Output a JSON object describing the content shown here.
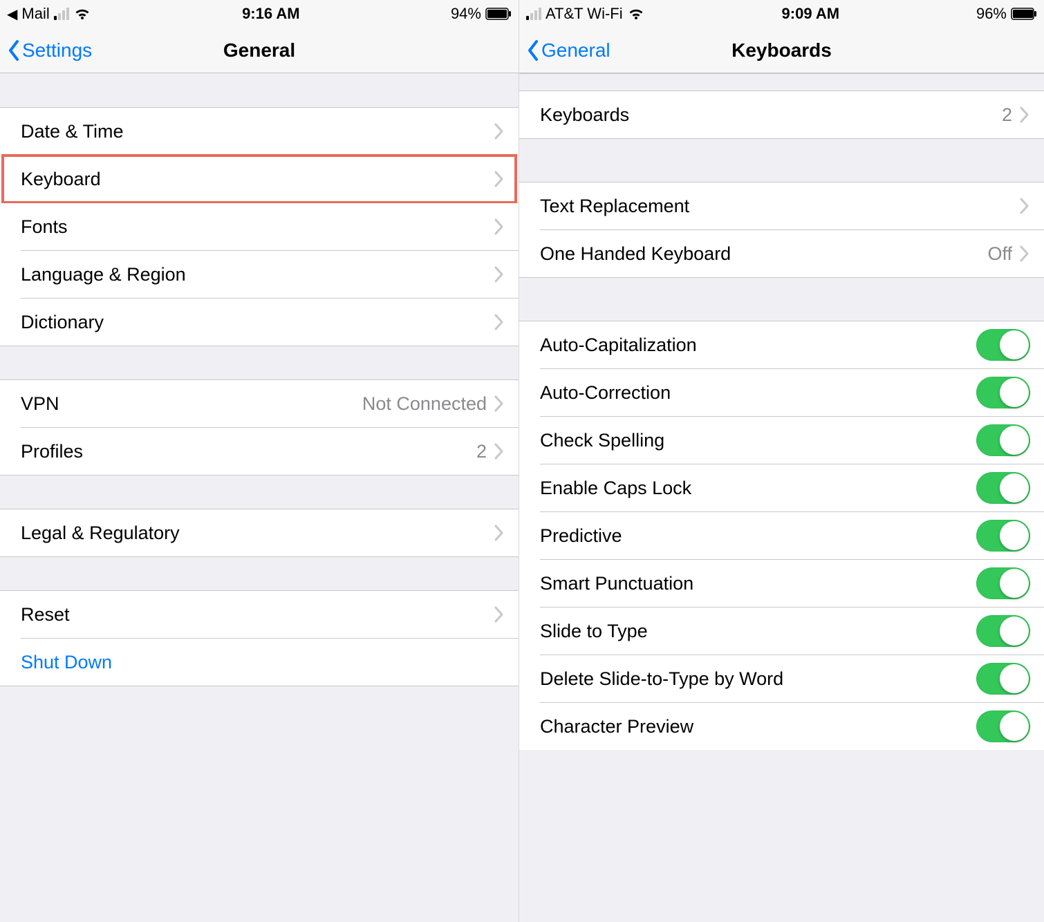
{
  "left": {
    "status": {
      "back_app_label": "Mail",
      "time": "9:16 AM",
      "battery_pct": "94%",
      "signal_active_bars": 1
    },
    "nav": {
      "back_label": "Settings",
      "title": "General"
    },
    "groups": [
      {
        "rows": [
          {
            "key": "date-time",
            "label": "Date & Time"
          },
          {
            "key": "keyboard",
            "label": "Keyboard",
            "highlight": true
          },
          {
            "key": "fonts",
            "label": "Fonts"
          },
          {
            "key": "language-region",
            "label": "Language & Region"
          },
          {
            "key": "dictionary",
            "label": "Dictionary"
          }
        ]
      },
      {
        "rows": [
          {
            "key": "vpn",
            "label": "VPN",
            "value": "Not Connected"
          },
          {
            "key": "profiles",
            "label": "Profiles",
            "value": "2"
          }
        ]
      },
      {
        "rows": [
          {
            "key": "legal",
            "label": "Legal & Regulatory"
          }
        ]
      },
      {
        "rows": [
          {
            "key": "reset",
            "label": "Reset"
          },
          {
            "key": "shutdown",
            "label": "Shut Down",
            "link": true,
            "no_chevron": true
          }
        ]
      }
    ]
  },
  "right": {
    "status": {
      "carrier_label": "AT&T Wi-Fi",
      "time": "9:09 AM",
      "battery_pct": "96%",
      "signal_active_bars": 1
    },
    "nav": {
      "back_label": "General",
      "title": "Keyboards"
    },
    "section_keyboards": {
      "label": "Keyboards",
      "value": "2"
    },
    "section_options": [
      {
        "key": "text-replacement",
        "label": "Text Replacement"
      },
      {
        "key": "one-handed",
        "label": "One Handed Keyboard",
        "value": "Off"
      }
    ],
    "toggles": [
      {
        "key": "auto-cap",
        "label": "Auto-Capitalization",
        "on": true
      },
      {
        "key": "auto-correct",
        "label": "Auto-Correction",
        "on": true
      },
      {
        "key": "check-spelling",
        "label": "Check Spelling",
        "on": true
      },
      {
        "key": "caps-lock",
        "label": "Enable Caps Lock",
        "on": true
      },
      {
        "key": "predictive",
        "label": "Predictive",
        "on": true
      },
      {
        "key": "smart-punct",
        "label": "Smart Punctuation",
        "on": true
      },
      {
        "key": "slide-type",
        "label": "Slide to Type",
        "on": true
      },
      {
        "key": "delete-slide-word",
        "label": "Delete Slide-to-Type by Word",
        "on": true
      },
      {
        "key": "char-preview",
        "label": "Character Preview",
        "on": true
      }
    ]
  }
}
